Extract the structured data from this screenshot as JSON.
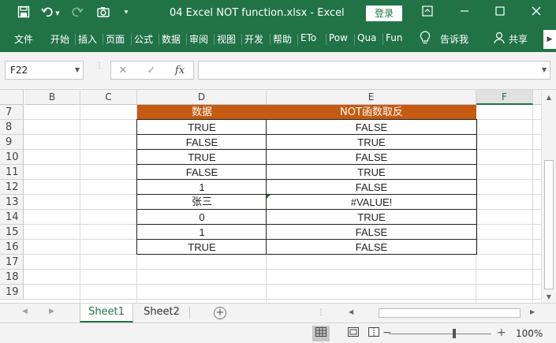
{
  "titlebar": {
    "title": "04 Excel NOT function.xlsx  -  Excel",
    "login": "登录",
    "save_icon": "save-icon",
    "undo_icon": "undo-icon",
    "redo_icon": "redo-icon",
    "camera_icon": "camera-icon"
  },
  "ribbon": {
    "tabs": [
      "文件",
      "开始",
      "插入",
      "页面",
      "公式",
      "数据",
      "审阅",
      "视图",
      "开发",
      "帮助",
      "ETo",
      "Pow",
      "Qua",
      "Fun"
    ],
    "tell_me": "告诉我",
    "share": "共享"
  },
  "formula_bar": {
    "name_box": "F22",
    "cancel_glyph": "✕",
    "enter_glyph": "✓",
    "fx_glyph": "fx",
    "formula": ""
  },
  "grid": {
    "columns": [
      "B",
      "C",
      "D",
      "E",
      "F"
    ],
    "rows": [
      "7",
      "8",
      "9",
      "10",
      "11",
      "12",
      "13",
      "14",
      "15",
      "16",
      "17",
      "18",
      "19"
    ],
    "header": {
      "d": "数据",
      "e": "NOT函数取反"
    },
    "data": [
      {
        "d": "TRUE",
        "e": "FALSE"
      },
      {
        "d": "FALSE",
        "e": "TRUE"
      },
      {
        "d": "TRUE",
        "e": "FALSE"
      },
      {
        "d": "FALSE",
        "e": "TRUE"
      },
      {
        "d": "1",
        "e": "FALSE"
      },
      {
        "d": "张三",
        "e": "#VALUE!"
      },
      {
        "d": "0",
        "e": "TRUE"
      },
      {
        "d": "1",
        "e": "FALSE"
      },
      {
        "d": "TRUE",
        "e": "FALSE"
      }
    ]
  },
  "sheets": [
    "Sheet1",
    "Sheet2"
  ],
  "status": {
    "zoom": "100%"
  },
  "colors": {
    "excel_green": "#217346",
    "header_fill": "#c55a11"
  }
}
